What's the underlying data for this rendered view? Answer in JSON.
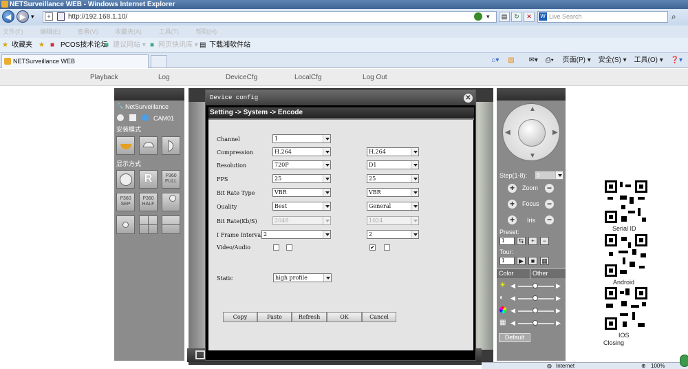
{
  "browser": {
    "window_title": "NETSurveillance WEB - Windows Internet Explorer",
    "address": "http://192.168.1.10/",
    "search_placeholder": "Live Search",
    "menu_items": [
      "文件(F)",
      "编辑(E)",
      "查看(V)",
      "收藏夹(A)",
      "工具(T)",
      "帮助(H)"
    ],
    "favorites": {
      "label": "收藏夹",
      "items": [
        "PCOS技术论坛",
        "建议网站 ▾",
        "网页快讯库 ▾",
        "下载湘软件站"
      ]
    },
    "tab_title": "NETSurveillance WEB",
    "commands": {
      "page": "页面(P) ▾",
      "safety": "安全(S) ▾",
      "tools": "工具(O) ▾",
      "help": "❓▾"
    },
    "status": {
      "zone": "Internet",
      "zoom": "100%"
    }
  },
  "nav": [
    "Playback",
    "Log",
    "DeviceCfg",
    "LocalCfg",
    "Log Out"
  ],
  "left_panel": {
    "brand": "NetSurveillance",
    "camera": "CAM01",
    "install_mode": "安装模式",
    "display_mode": "显示方式",
    "buttons": {
      "p360_full": "P360 FULL",
      "r": "R",
      "p360_sep": "P360 SEP",
      "p360_half": "P360 HALF"
    }
  },
  "dialog": {
    "title": "Device config",
    "breadcrumb": "Setting -> System -> Encode",
    "labels": {
      "channel": "Channel",
      "compression": "Compression",
      "resolution": "Resolution",
      "fps": "FPS",
      "bitrate_type": "Bit Rate Type",
      "quality": "Quality",
      "bitrate": "Bit Rate(Kb/S)",
      "iframe": "I Frame Interval",
      "video_audio": "Video/Audio",
      "static": "Static"
    },
    "main_stream": {
      "channel": "1",
      "compression": "H.264",
      "resolution": "720P",
      "fps": "25",
      "bitrate_type": "VBR",
      "quality": "Best",
      "bitrate": "2048",
      "iframe": "2",
      "video_checked": false,
      "audio_checked": false
    },
    "extra_stream": {
      "compression": "H.264",
      "resolution": "D1",
      "fps": "25",
      "bitrate_type": "VBR",
      "quality": "General",
      "bitrate": "1024",
      "iframe": "2",
      "video_checked": true,
      "audio_checked": false
    },
    "static": "high profile",
    "buttons": [
      "Copy",
      "Paste",
      "Refresh",
      "OK",
      "Cancel"
    ]
  },
  "right_panel": {
    "step_label": "Step(1-8):",
    "step_value": "5",
    "zoom": "Zoom",
    "focus": "Focus",
    "iris": "Iris",
    "preset": "Preset:",
    "preset_value": "1",
    "tour": "Tour:",
    "tour_value": "1",
    "tabs": [
      "Color",
      "Other"
    ],
    "default": "Default"
  },
  "qr": {
    "serial": "Serial ID",
    "android": "Android",
    "ios": "IOS",
    "closing": "Closing"
  }
}
